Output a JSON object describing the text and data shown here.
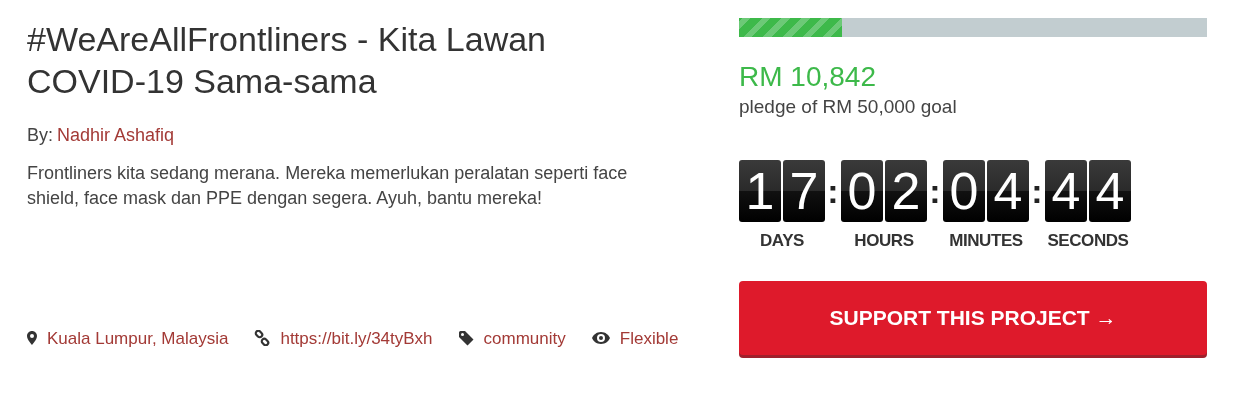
{
  "title": "#WeAreAllFrontliners - Kita Lawan COVID-19 Sama-sama",
  "byline": {
    "label": "By:",
    "author": "Nadhir Ashafiq"
  },
  "description": "Frontliners kita sedang merana. Mereka memerlukan peralatan seperti face shield, face mask dan PPE dengan segera. Ayuh, bantu mereka!",
  "meta": [
    {
      "kind": "location",
      "text": "Kuala Lumpur, Malaysia"
    },
    {
      "kind": "link",
      "text": "https://bit.ly/34tyBxh"
    },
    {
      "kind": "tag",
      "text": "community"
    },
    {
      "kind": "eye",
      "text": "Flexible"
    }
  ],
  "progress": {
    "level": 0.22
  },
  "raised": "RM 10,842",
  "goal": "pledge of RM 50,000 goal",
  "countdown": [
    {
      "digits": [
        "1",
        "7"
      ],
      "label": "DAYS"
    },
    {
      "digits": [
        "0",
        "2"
      ],
      "label": "HOURS"
    },
    {
      "digits": [
        "0",
        "4"
      ],
      "label": "MINUTES"
    },
    {
      "digits": [
        "4",
        "4"
      ],
      "label": "SECONDS"
    }
  ],
  "separator": ":",
  "button": "SUPPORT THIS PROJECT →"
}
